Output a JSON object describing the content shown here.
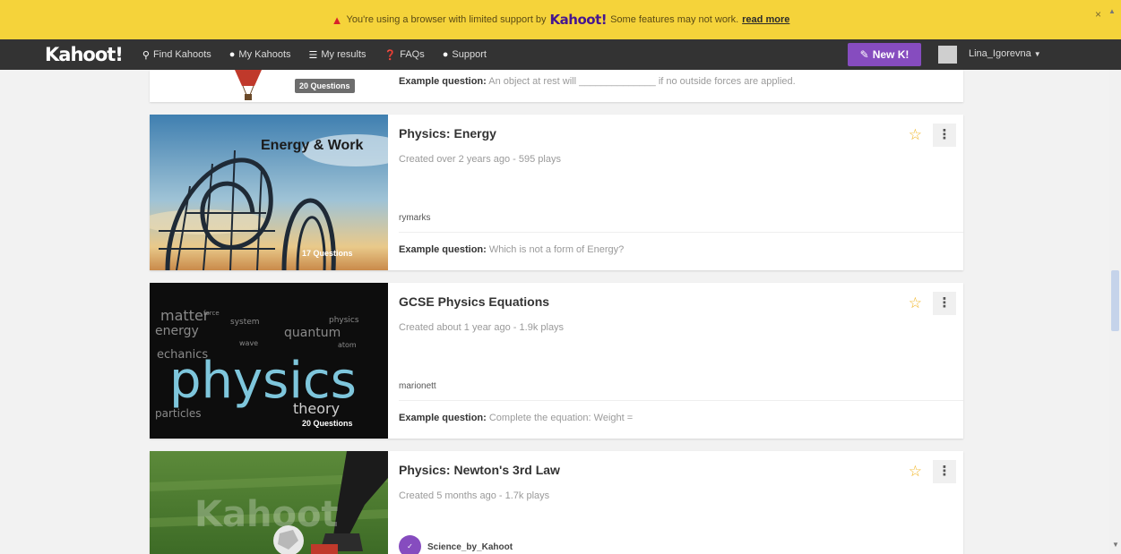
{
  "banner": {
    "message": "You're using a browser with limited support by",
    "brand": "Kahoot!",
    "message_tail": "Some features may not work.",
    "read_more": "read more",
    "close": "×",
    "warning_color": "#d8232a"
  },
  "nav": {
    "logo": "Kahoot!",
    "items": [
      {
        "label": "Find Kahoots",
        "icon": "search-icon"
      },
      {
        "label": "My Kahoots",
        "icon": "user-icon"
      },
      {
        "label": "My results",
        "icon": "list-icon"
      },
      {
        "label": "FAQs",
        "icon": "question-icon"
      },
      {
        "label": "Support",
        "icon": "chat-icon"
      }
    ],
    "new_button": "New K!",
    "user": "Lina_Igorevna",
    "accent_color": "#864cbf"
  },
  "cards": [
    {
      "title": "",
      "questions": "20 Questions",
      "example_label": "Example question:",
      "example_text": "An object at rest will ______________ if no outside forces are applied."
    },
    {
      "title": "Physics: Energy",
      "meta": "Created over 2 years ago - 595 plays",
      "author": "rymarks",
      "questions": "17 Questions",
      "thumb_text": "Energy & Work",
      "example_label": "Example question:",
      "example_text": "Which is not a form of Energy?"
    },
    {
      "title": "GCSE Physics Equations",
      "meta": "Created about 1 year ago - 1.9k plays",
      "author": "marionett",
      "questions": "20 Questions",
      "example_label": "Example question:",
      "example_text": "Complete the equation: Weight ="
    },
    {
      "title": "Physics: Newton's 3rd Law",
      "meta": "Created 5 months ago - 1.7k plays",
      "author": "Science_by_Kahoot",
      "thumb_text": "Kahoot"
    }
  ]
}
